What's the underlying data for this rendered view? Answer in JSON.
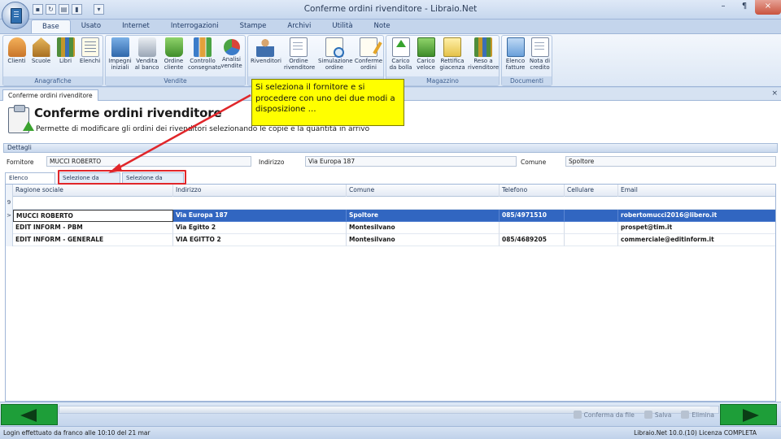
{
  "window": {
    "title": "Conferme ordini rivenditore - Libraio.Net",
    "controls": [
      "–",
      "¶",
      "×"
    ]
  },
  "qat_icons": [
    "save-icon",
    "refresh-icon",
    "print-icon",
    "delete-icon",
    "dropdown-icon"
  ],
  "ribbon": {
    "tabs": [
      "Base",
      "Usato",
      "Internet",
      "Interrogazioni",
      "Stampe",
      "Archivi",
      "Utilità",
      "Note"
    ],
    "active_tab": "Base",
    "groups": [
      {
        "title": "Anagrafiche",
        "buttons": [
          [
            "Clienti",
            ""
          ],
          [
            "Scuole",
            ""
          ],
          [
            "Libri",
            ""
          ],
          [
            "Elenchi",
            ""
          ]
        ]
      },
      {
        "title": "Vendite",
        "buttons": [
          [
            "Impegni",
            "iniziali"
          ],
          [
            "Vendita",
            "al banco"
          ],
          [
            "Ordine",
            "cliente"
          ],
          [
            "Controllo",
            "consegnato"
          ],
          [
            "Analisi",
            "vendite"
          ]
        ]
      },
      {
        "title": "",
        "buttons": [
          [
            "Rivenditori",
            ""
          ],
          [
            "Ordine",
            "rivenditore"
          ],
          [
            "Simulazione",
            "ordine"
          ],
          [
            "Conferme",
            "ordini"
          ]
        ]
      },
      {
        "title": "Magazzino",
        "buttons": [
          [
            "Carico",
            "da bolla"
          ],
          [
            "Carico",
            "veloce"
          ],
          [
            "Rettifica",
            "giacenza"
          ],
          [
            "Reso a",
            "rivenditore"
          ]
        ]
      },
      {
        "title": "Documenti",
        "buttons": [
          [
            "Elenco",
            "fatture"
          ],
          [
            "Nota di",
            "credito"
          ]
        ]
      }
    ]
  },
  "doc_tab": {
    "label": "Conferme ordini rivenditore",
    "close": "×"
  },
  "page": {
    "title": "Conferme ordini rivenditore",
    "subtitle": "Permette di modificare gli ordini dei rivenditori selezionando le copie e la quantità in arrivo"
  },
  "details": {
    "section_title": "Dettagli",
    "fornitore_label": "Fornitore",
    "fornitore_value": "MUCCI ROBERTO",
    "indirizzo_label": "Indirizzo",
    "indirizzo_value": "Via Europa 187",
    "comune_label": "Comune",
    "comune_value": "Spoltore"
  },
  "subtabs": [
    "Elenco fornitori",
    "Selezione da ordine",
    "Selezione da codice"
  ],
  "grid": {
    "columns": [
      "Ragione sociale",
      "Indirizzo",
      "Comune",
      "Telefono",
      "Cellulare",
      "Email"
    ],
    "filter_symbol": "9",
    "row_indicator": ">",
    "rows": [
      [
        "MUCCI ROBERTO",
        "Via Europa 187",
        "Spoltore",
        "085/4971510",
        "",
        "robertomucci2016@libero.it"
      ],
      [
        "EDIT INFORM - PBM",
        "Via Egitto 2",
        "Montesilvano",
        "",
        "",
        "prospet@tim.it"
      ],
      [
        "EDIT INFORM - GENERALE",
        "VIA EGITTO 2",
        "Montesilvano",
        "085/4689205",
        "",
        "commerciale@editinform.it"
      ]
    ]
  },
  "callout": {
    "text": "Si seleziona il fornitore e si procedere con uno dei due modi a disposizione …"
  },
  "footer_actions": [
    "Conferma da file",
    "Salva",
    "Elimina"
  ],
  "status": {
    "left": "Login effettuato da franco alle 10:10 del 21 mar",
    "right": "Libraio.Net 10.0.(10) Licenza COMPLETA"
  },
  "colors": {
    "selection": "#3166c1",
    "callout_bg": "#ffff00",
    "highlight_red": "#e0262a",
    "nav_green": "#1e9e39"
  }
}
